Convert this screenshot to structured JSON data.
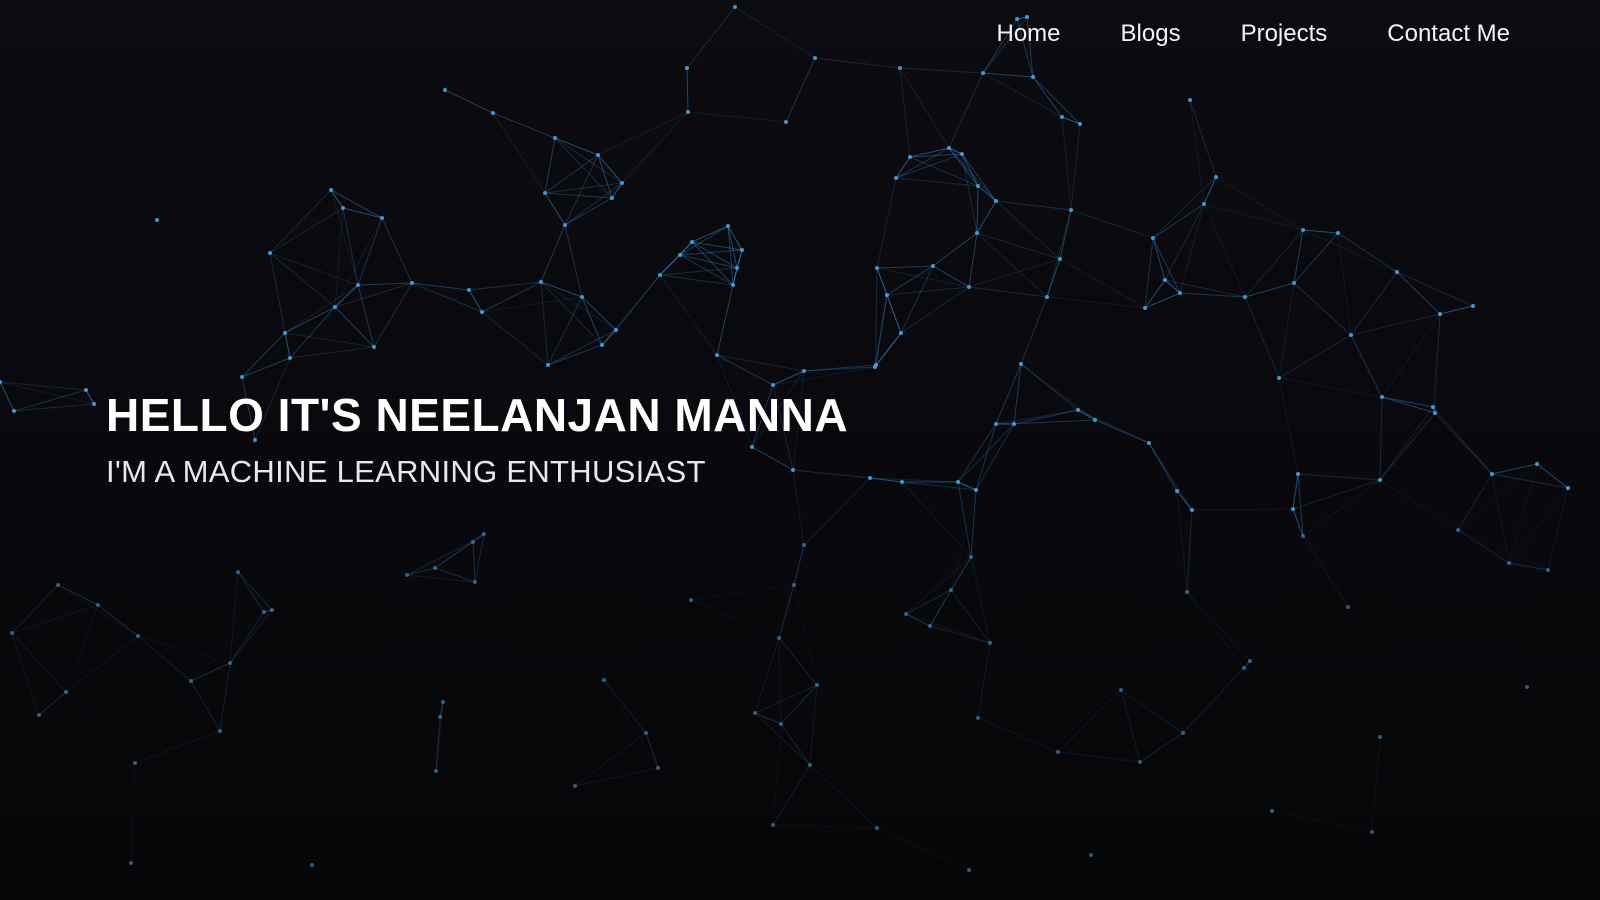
{
  "nav": {
    "items": [
      {
        "label": "Home"
      },
      {
        "label": "Blogs"
      },
      {
        "label": "Projects"
      },
      {
        "label": "Contact Me"
      }
    ]
  },
  "hero": {
    "title": "HELLO IT'S NEELANJAN MANNA",
    "subtitle": "I'M A MACHINE LEARNING ENTHUSIAST"
  },
  "colors": {
    "background": "#0a090d",
    "network_line": "#3a8fd0",
    "network_node": "#4aa3e0",
    "text": "#ffffff"
  },
  "background": {
    "type": "particle-network"
  }
}
